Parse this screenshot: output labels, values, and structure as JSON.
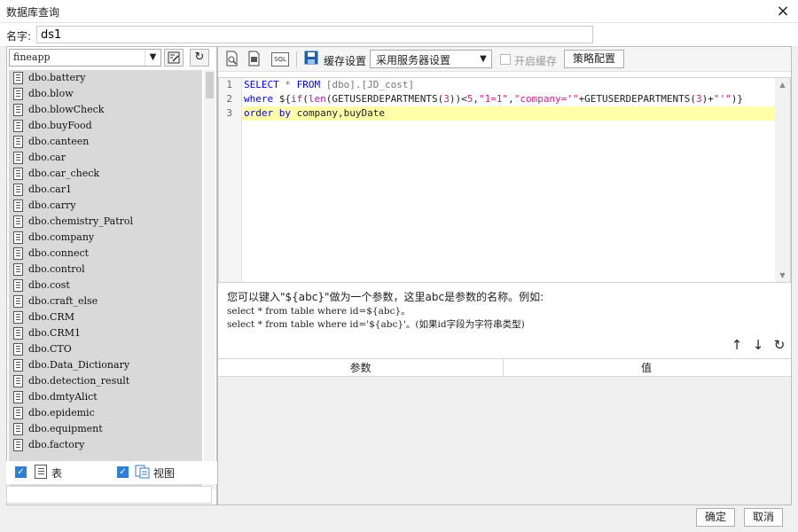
{
  "window": {
    "title": "数据库查询",
    "close_icon": "×"
  },
  "name_row": {
    "label": "名字:",
    "value": "ds1"
  },
  "left": {
    "connection": "fineapp",
    "tables": [
      "dbo.battery",
      "dbo.blow",
      "dbo.blowCheck",
      "dbo.buyFood",
      "dbo.canteen",
      "dbo.car",
      "dbo.car_check",
      "dbo.car1",
      "dbo.carry",
      "dbo.chemistry_Patrol",
      "dbo.company",
      "dbo.connect",
      "dbo.control",
      "dbo.cost",
      "dbo.craft_else",
      "dbo.CRM",
      "dbo.CRM1",
      "dbo.CTO",
      "dbo.Data_Dictionary",
      "dbo.detection_result",
      "dbo.dmtyAlict",
      "dbo.epidemic",
      "dbo.equipment",
      "dbo.factory"
    ],
    "checkbox_table_label": "表",
    "checkbox_view_label": "视图"
  },
  "toolbar": {
    "cache_label": "缓存设置",
    "cache_option": "采用服务器设置",
    "enable_cache_label": "开启缓存",
    "policy_button": "策略配置",
    "sql_icon_text": "SQL"
  },
  "editor": {
    "line_numbers": [
      "1",
      "2",
      "3"
    ]
  },
  "hint": {
    "line1": "您可以键入\"${abc}\"做为一个参数，这里abc是参数的名称。例如:",
    "line2": "select * from table where id=${abc}。",
    "line3": "select * from table where id='${abc}'。(如果id字段为字符串类型)"
  },
  "params": {
    "col_param": "参数",
    "col_value": "值"
  },
  "footer": {
    "ok": "确定",
    "cancel": "取消"
  }
}
